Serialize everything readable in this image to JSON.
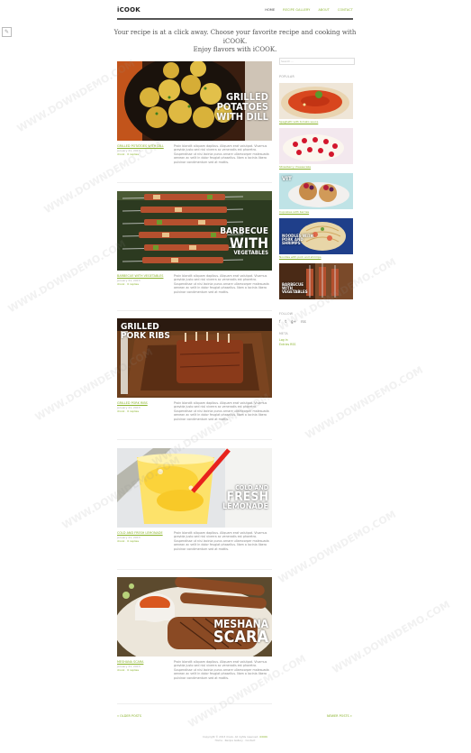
{
  "site": {
    "logo": "iCOOK",
    "nav": [
      "HOME",
      "RECIPE GALLERY",
      "ABOUT",
      "CONTACT"
    ],
    "tagline_line1": "Your recipe is at a click away. Choose your favorite recipe and cooking with iCOOK.",
    "tagline_line2": "Enjoy flavors with iCOOK."
  },
  "posts": [
    {
      "title": "GRILLED POTATOES WITH DILL",
      "overlay": [
        "GRILLED",
        "POTATOES",
        "WITH DILL"
      ],
      "date": "January 21, 2013",
      "by": "by",
      "author": "iCook",
      "comments": "0 replies",
      "excerpt": "Proin blandit aliquam dapibus. Aliquam erat volutpat. Vivamus gravida justo sed nisl viverra ac venenatis est pharetra. Suspendisse ut nisi lacinia purus ornare ullamcorper malesuada aenean ac velit in dolor feugiat phasellus. Nam a lacinia libero pulvinar condimentum sed at mattis."
    },
    {
      "title": "BARBECUE WITH VEGETABLES",
      "overlay": [
        "BARBECUE",
        "WITH",
        "VEGETABLES"
      ],
      "date": "January 21, 2013",
      "by": "by",
      "author": "iCook",
      "comments": "0 replies",
      "excerpt": "Proin blandit aliquam dapibus. Aliquam erat volutpat. Vivamus gravida justo sed nisl viverra ac venenatis est pharetra. Suspendisse ut nisi lacinia purus ornare ullamcorper malesuada aenean ac velit in dolor feugiat phasellus. Nam a lacinia libero pulvinar condimentum sed at mattis."
    },
    {
      "title": "GRILLED PORK RIBS",
      "overlay": [
        "GRILLED",
        "PORK RIBS"
      ],
      "date": "January 21, 2013",
      "by": "by",
      "author": "iCook",
      "comments": "0 replies",
      "excerpt": "Proin blandit aliquam dapibus. Aliquam erat volutpat. Vivamus gravida justo sed nisl viverra ac venenatis est pharetra. Suspendisse ut nisi lacinia purus ornare ullamcorper malesuada aenean ac velit in dolor feugiat phasellus. Nam a lacinia libero pulvinar condimentum sed at mattis."
    },
    {
      "title": "COLD AND FRESH LEMONADE",
      "overlay": [
        "COLD AND",
        "FRESH",
        "LEMONADE"
      ],
      "date": "January 21, 2013",
      "by": "by",
      "author": "iCook",
      "comments": "0 replies",
      "excerpt": "Proin blandit aliquam dapibus. Aliquam erat volutpat. Vivamus gravida justo sed nisl viverra ac venenatis est pharetra. Suspendisse ut nisi lacinia purus ornare ullamcorper malesuada aenean ac velit in dolor feugiat phasellus. Nam a lacinia libero pulvinar condimentum sed at mattis."
    },
    {
      "title": "MESHANA SCARA",
      "overlay": [
        "MESHANA",
        "SCARA"
      ],
      "date": "January 21, 2013",
      "by": "by",
      "author": "iCook",
      "comments": "0 replies",
      "excerpt": "Proin blandit aliquam dapibus. Aliquam erat volutpat. Vivamus gravida justo sed nisl viverra ac venenatis est pharetra. Suspendisse ut nisi lacinia purus ornare ullamcorper malesuada aenean ac velit in dolor feugiat phasellus. Nam a lacinia libero pulvinar condimentum sed at mattis."
    }
  ],
  "sidebar": {
    "search_placeholder": "Search ...",
    "popular_title": "POPULAR",
    "popular": [
      {
        "label": "Spaghetti with tomato sauce",
        "overlay": ""
      },
      {
        "label": "Strawberry cheesecake",
        "overlay": ""
      },
      {
        "label": "Cupcakes with berries",
        "overlay": "VIT"
      },
      {
        "label": "Noodles with pork and shrimps",
        "overlay": "NOODLES WITH PORK AND SHRIMPS"
      },
      {
        "label": "Barbecue with vegetables",
        "overlay": "BARBECUE WITH VEGETABLES"
      }
    ],
    "follow_title": "FOLLOW",
    "social": [
      "f",
      "t",
      "g+",
      "rss"
    ],
    "meta_title": "META",
    "meta_links": [
      "Log in",
      "Entries RSS"
    ]
  },
  "pagination": {
    "older": "« OLDER POSTS",
    "newer": "NEWER POSTS »"
  },
  "footer": {
    "line1": "Copyright © 2013 iCook. All rights reserved.",
    "brand": "iCOOK",
    "line2": "Home · Recipe Gallery · Contact"
  },
  "watermark": "WWW.DOWNDEMO.COM"
}
